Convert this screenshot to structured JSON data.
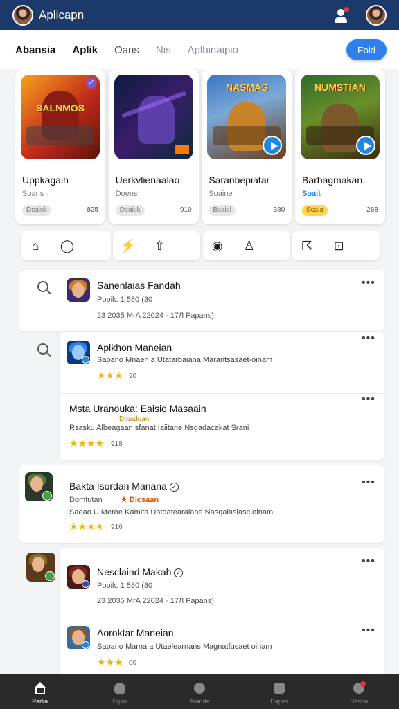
{
  "header": {
    "title": "Aplicapn",
    "user_icon": "user-alert-icon",
    "avatar": "profile-avatar"
  },
  "tabs": [
    {
      "label": "Abansia"
    },
    {
      "label": "Aplik"
    },
    {
      "label": "Oans"
    },
    {
      "label": "Nis"
    },
    {
      "label": "Aplbinaipio"
    }
  ],
  "edit_button": "Eoid",
  "featured": [
    {
      "art_text": "SALNMOS",
      "title": "Uppkagaih",
      "sub": "Soans",
      "pill": "Dsaisk",
      "num": "825"
    },
    {
      "art_text": "",
      "title": "Uerkvlienaalao",
      "sub": "Doens",
      "pill": "Dsaisk",
      "num": "910"
    },
    {
      "art_text": "NASMAS",
      "title": "Saranbepiatar",
      "sub": "Soaine",
      "pill": "Bsaisl",
      "num": "380"
    },
    {
      "art_text": "NUMSTIAN",
      "title": "Barbagmakan",
      "sub": "Soait",
      "pill": "Scaia",
      "num": "268"
    }
  ],
  "icon_groups": [
    [
      "home-icon",
      "chat-icon"
    ],
    [
      "run-icon",
      "share-icon"
    ],
    [
      "record-icon",
      "person-icon"
    ],
    [
      "walk-icon",
      "trash-icon"
    ]
  ],
  "rows": [
    {
      "title": "Sanenlaias Fandah",
      "meta": "Popik: 1 580 (30",
      "date": "23 2035 MrA 22024 · 17Л Раpans)"
    },
    {
      "title": "Aplkhon Maneian",
      "desc": "Sapano Mnaen a Utatarbaiana Marantsasaet-oinam",
      "rating": "90"
    },
    {
      "title": "Msta Uranouka: Eaisio Masaain",
      "tag": "Dtoaduan",
      "desc": "Rsasku Albeagaan sfanat Iaiitane Nsgadacakat Srani",
      "rating": "918"
    },
    {
      "title": "Bakta Isordan Manana",
      "meta": "Domtutan",
      "tag": "Dicsaan",
      "desc": "Saeao U Meroe Kamita Uatdatearaiane Nasqalasiasc oinam",
      "rating": "916"
    },
    {
      "title": "Nesclaind Makah",
      "meta": "Popik: 1 580 (30",
      "date": "23 2035 MrA 22024 · 17Л Раpans)"
    },
    {
      "title": "Aoroktar Maneian",
      "desc": "Sapano Marna a Utaelearnans Magnatfusaet oinam",
      "rating": "00"
    }
  ],
  "bottom_nav": [
    {
      "label": "Parlia"
    },
    {
      "label": "Diplo"
    },
    {
      "label": "Aranda"
    },
    {
      "label": "Dapes"
    },
    {
      "label": "Sasha"
    }
  ],
  "colors": {
    "header": "#1b3a6b",
    "accent": "#2f80ed",
    "star": "#f5b301",
    "nav": "#2a2a2a"
  }
}
